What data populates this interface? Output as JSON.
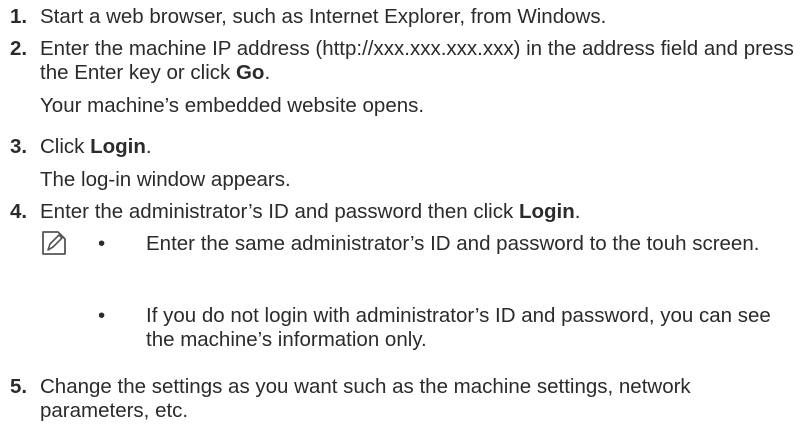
{
  "steps": [
    {
      "number": "1.",
      "text": "Start a web browser, such as Internet Explorer, from Windows."
    },
    {
      "number": "2.",
      "text_before": "Enter the machine IP address (http://xxx.xxx.xxx.xxx) in the address field and press the Enter key or click ",
      "bold": "Go",
      "text_after": ".",
      "result": "Your machine’s embedded website opens."
    },
    {
      "number": "3.",
      "text_before": "Click ",
      "bold": "Login",
      "text_after": ".",
      "result": "The log-in window appears."
    },
    {
      "number": "4.",
      "text_before": "Enter the administrator’s ID and password then click ",
      "bold": "Login",
      "text_after": ".",
      "notes": [
        {
          "bullet": "•",
          "text": "Enter the same administrator’s ID and password to the touh screen."
        },
        {
          "bullet": "•",
          "text": "If you do not login with administrator’s ID and password, you can see the machine’s information only."
        }
      ]
    },
    {
      "number": "5.",
      "text": "Change the settings as you want such as the machine settings, network parameters, etc."
    }
  ],
  "note_icon": "note-pencil-icon",
  "colors": {
    "text": "#2b2b2b",
    "icon": "#555555"
  }
}
